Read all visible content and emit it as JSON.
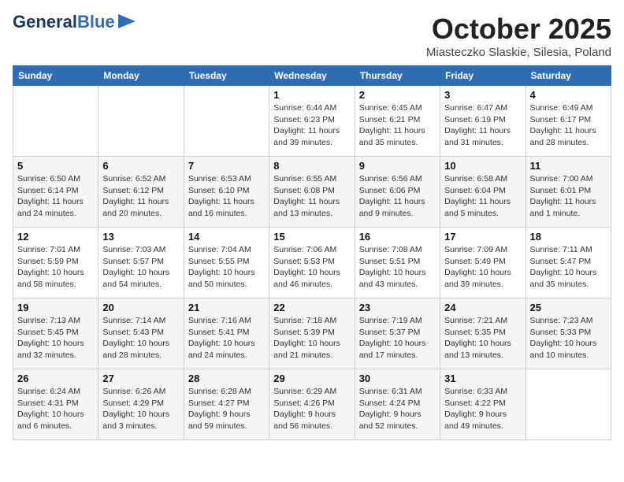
{
  "header": {
    "logo_line1": "General",
    "logo_line2": "Blue",
    "month": "October 2025",
    "location": "Miasteczko Slaskie, Silesia, Poland"
  },
  "weekdays": [
    "Sunday",
    "Monday",
    "Tuesday",
    "Wednesday",
    "Thursday",
    "Friday",
    "Saturday"
  ],
  "weeks": [
    [
      {
        "day": "",
        "sunrise": "",
        "sunset": "",
        "daylight": ""
      },
      {
        "day": "",
        "sunrise": "",
        "sunset": "",
        "daylight": ""
      },
      {
        "day": "",
        "sunrise": "",
        "sunset": "",
        "daylight": ""
      },
      {
        "day": "1",
        "sunrise": "Sunrise: 6:44 AM",
        "sunset": "Sunset: 6:23 PM",
        "daylight": "Daylight: 11 hours and 39 minutes."
      },
      {
        "day": "2",
        "sunrise": "Sunrise: 6:45 AM",
        "sunset": "Sunset: 6:21 PM",
        "daylight": "Daylight: 11 hours and 35 minutes."
      },
      {
        "day": "3",
        "sunrise": "Sunrise: 6:47 AM",
        "sunset": "Sunset: 6:19 PM",
        "daylight": "Daylight: 11 hours and 31 minutes."
      },
      {
        "day": "4",
        "sunrise": "Sunrise: 6:49 AM",
        "sunset": "Sunset: 6:17 PM",
        "daylight": "Daylight: 11 hours and 28 minutes."
      }
    ],
    [
      {
        "day": "5",
        "sunrise": "Sunrise: 6:50 AM",
        "sunset": "Sunset: 6:14 PM",
        "daylight": "Daylight: 11 hours and 24 minutes."
      },
      {
        "day": "6",
        "sunrise": "Sunrise: 6:52 AM",
        "sunset": "Sunset: 6:12 PM",
        "daylight": "Daylight: 11 hours and 20 minutes."
      },
      {
        "day": "7",
        "sunrise": "Sunrise: 6:53 AM",
        "sunset": "Sunset: 6:10 PM",
        "daylight": "Daylight: 11 hours and 16 minutes."
      },
      {
        "day": "8",
        "sunrise": "Sunrise: 6:55 AM",
        "sunset": "Sunset: 6:08 PM",
        "daylight": "Daylight: 11 hours and 13 minutes."
      },
      {
        "day": "9",
        "sunrise": "Sunrise: 6:56 AM",
        "sunset": "Sunset: 6:06 PM",
        "daylight": "Daylight: 11 hours and 9 minutes."
      },
      {
        "day": "10",
        "sunrise": "Sunrise: 6:58 AM",
        "sunset": "Sunset: 6:04 PM",
        "daylight": "Daylight: 11 hours and 5 minutes."
      },
      {
        "day": "11",
        "sunrise": "Sunrise: 7:00 AM",
        "sunset": "Sunset: 6:01 PM",
        "daylight": "Daylight: 11 hours and 1 minute."
      }
    ],
    [
      {
        "day": "12",
        "sunrise": "Sunrise: 7:01 AM",
        "sunset": "Sunset: 5:59 PM",
        "daylight": "Daylight: 10 hours and 58 minutes."
      },
      {
        "day": "13",
        "sunrise": "Sunrise: 7:03 AM",
        "sunset": "Sunset: 5:57 PM",
        "daylight": "Daylight: 10 hours and 54 minutes."
      },
      {
        "day": "14",
        "sunrise": "Sunrise: 7:04 AM",
        "sunset": "Sunset: 5:55 PM",
        "daylight": "Daylight: 10 hours and 50 minutes."
      },
      {
        "day": "15",
        "sunrise": "Sunrise: 7:06 AM",
        "sunset": "Sunset: 5:53 PM",
        "daylight": "Daylight: 10 hours and 46 minutes."
      },
      {
        "day": "16",
        "sunrise": "Sunrise: 7:08 AM",
        "sunset": "Sunset: 5:51 PM",
        "daylight": "Daylight: 10 hours and 43 minutes."
      },
      {
        "day": "17",
        "sunrise": "Sunrise: 7:09 AM",
        "sunset": "Sunset: 5:49 PM",
        "daylight": "Daylight: 10 hours and 39 minutes."
      },
      {
        "day": "18",
        "sunrise": "Sunrise: 7:11 AM",
        "sunset": "Sunset: 5:47 PM",
        "daylight": "Daylight: 10 hours and 35 minutes."
      }
    ],
    [
      {
        "day": "19",
        "sunrise": "Sunrise: 7:13 AM",
        "sunset": "Sunset: 5:45 PM",
        "daylight": "Daylight: 10 hours and 32 minutes."
      },
      {
        "day": "20",
        "sunrise": "Sunrise: 7:14 AM",
        "sunset": "Sunset: 5:43 PM",
        "daylight": "Daylight: 10 hours and 28 minutes."
      },
      {
        "day": "21",
        "sunrise": "Sunrise: 7:16 AM",
        "sunset": "Sunset: 5:41 PM",
        "daylight": "Daylight: 10 hours and 24 minutes."
      },
      {
        "day": "22",
        "sunrise": "Sunrise: 7:18 AM",
        "sunset": "Sunset: 5:39 PM",
        "daylight": "Daylight: 10 hours and 21 minutes."
      },
      {
        "day": "23",
        "sunrise": "Sunrise: 7:19 AM",
        "sunset": "Sunset: 5:37 PM",
        "daylight": "Daylight: 10 hours and 17 minutes."
      },
      {
        "day": "24",
        "sunrise": "Sunrise: 7:21 AM",
        "sunset": "Sunset: 5:35 PM",
        "daylight": "Daylight: 10 hours and 13 minutes."
      },
      {
        "day": "25",
        "sunrise": "Sunrise: 7:23 AM",
        "sunset": "Sunset: 5:33 PM",
        "daylight": "Daylight: 10 hours and 10 minutes."
      }
    ],
    [
      {
        "day": "26",
        "sunrise": "Sunrise: 6:24 AM",
        "sunset": "Sunset: 4:31 PM",
        "daylight": "Daylight: 10 hours and 6 minutes."
      },
      {
        "day": "27",
        "sunrise": "Sunrise: 6:26 AM",
        "sunset": "Sunset: 4:29 PM",
        "daylight": "Daylight: 10 hours and 3 minutes."
      },
      {
        "day": "28",
        "sunrise": "Sunrise: 6:28 AM",
        "sunset": "Sunset: 4:27 PM",
        "daylight": "Daylight: 9 hours and 59 minutes."
      },
      {
        "day": "29",
        "sunrise": "Sunrise: 6:29 AM",
        "sunset": "Sunset: 4:26 PM",
        "daylight": "Daylight: 9 hours and 56 minutes."
      },
      {
        "day": "30",
        "sunrise": "Sunrise: 6:31 AM",
        "sunset": "Sunset: 4:24 PM",
        "daylight": "Daylight: 9 hours and 52 minutes."
      },
      {
        "day": "31",
        "sunrise": "Sunrise: 6:33 AM",
        "sunset": "Sunset: 4:22 PM",
        "daylight": "Daylight: 9 hours and 49 minutes."
      },
      {
        "day": "",
        "sunrise": "",
        "sunset": "",
        "daylight": ""
      }
    ]
  ]
}
